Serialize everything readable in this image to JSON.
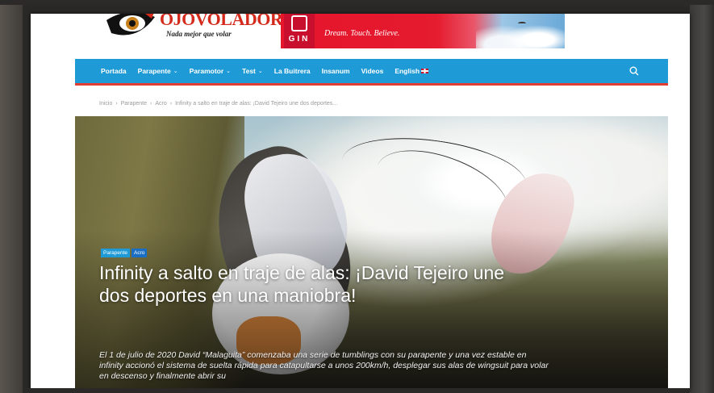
{
  "logo": {
    "name": "OJOVOLADOR",
    "tagline": "Nada mejor que volar"
  },
  "banner": {
    "brand": "GIN",
    "slogan": "Dream. Touch. Believe."
  },
  "nav": {
    "items": [
      {
        "label": "Portada",
        "dropdown": false
      },
      {
        "label": "Parapente",
        "dropdown": true
      },
      {
        "label": "Paramotor",
        "dropdown": true
      },
      {
        "label": "Test",
        "dropdown": true
      },
      {
        "label": "La Buitrera",
        "dropdown": false
      },
      {
        "label": "Insanum",
        "dropdown": false
      },
      {
        "label": "Videos",
        "dropdown": false
      },
      {
        "label": "English",
        "dropdown": false
      }
    ],
    "search_icon": "search-icon"
  },
  "breadcrumb": {
    "items": [
      "Inicio",
      "Parapente",
      "Acro",
      "Infinity a salto en traje de alas: ¡David Tejeiro une dos deportes..."
    ]
  },
  "article": {
    "tags": [
      "Parapente",
      "Acro"
    ],
    "title": "Infinity a salto en traje de alas: ¡David Tejeiro une dos deportes en una maniobra!",
    "excerpt": "El 1 de julio de 2020 David “Malaguita” comenzaba una serie de tumblings con su parapente y una vez estable en infinity accionó el sistema de suelta rápida para catapultarse a unos 200km/h, desplegar sus alas de wingsuit para volar en descenso y finalmente abrir su"
  },
  "colors": {
    "nav_bg": "#1e9ad6",
    "nav_border": "#e03c31",
    "logo_red": "#d42a1c"
  }
}
